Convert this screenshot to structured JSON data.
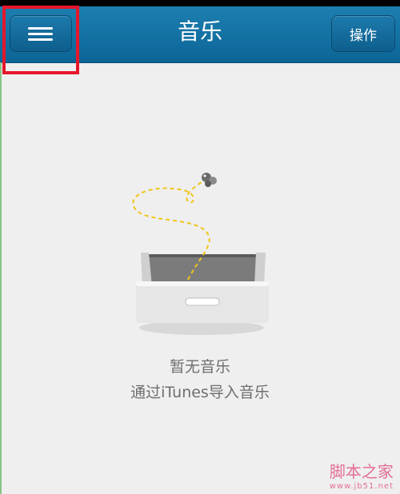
{
  "header": {
    "title": "音乐",
    "action_label": "操作",
    "menu_icon": "hamburger-menu-icon"
  },
  "empty_state": {
    "title": "暂无音乐",
    "subtitle": "通过iTunes导入音乐",
    "illustration_icon": "empty-drawer-icon"
  },
  "watermark": {
    "main": "脚本之家",
    "sub": "www.jb51.net"
  },
  "colors": {
    "navbar": "#0c6597",
    "highlight": "#e5172c",
    "background": "#efefef",
    "text_muted": "#6e6e6e"
  }
}
